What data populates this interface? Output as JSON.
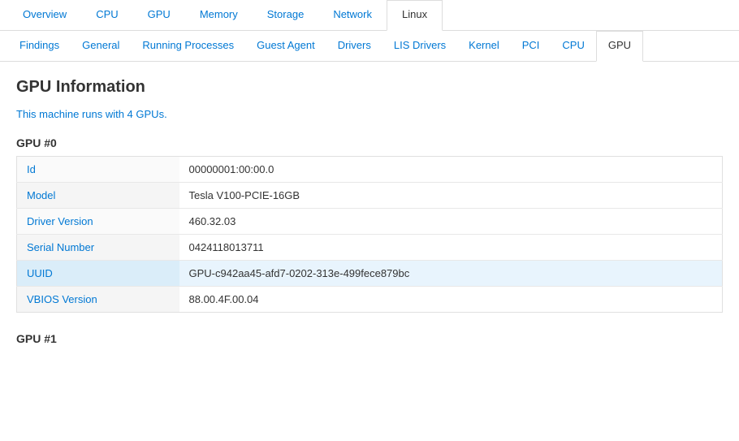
{
  "topNav": {
    "items": [
      {
        "label": "Overview",
        "active": false
      },
      {
        "label": "CPU",
        "active": false
      },
      {
        "label": "GPU",
        "active": false
      },
      {
        "label": "Memory",
        "active": false
      },
      {
        "label": "Storage",
        "active": false
      },
      {
        "label": "Network",
        "active": false
      },
      {
        "label": "Linux",
        "active": true
      }
    ]
  },
  "secondNav": {
    "items": [
      {
        "label": "Findings",
        "active": false
      },
      {
        "label": "General",
        "active": false
      },
      {
        "label": "Running Processes",
        "active": false
      },
      {
        "label": "Guest Agent",
        "active": false
      },
      {
        "label": "Drivers",
        "active": false
      },
      {
        "label": "LIS Drivers",
        "active": false
      },
      {
        "label": "Kernel",
        "active": false
      },
      {
        "label": "PCI",
        "active": false
      },
      {
        "label": "CPU",
        "active": false
      },
      {
        "label": "GPU",
        "active": true
      }
    ]
  },
  "pageTitle": "GPU Information",
  "gpuSummary": "This machine runs with 4 GPUs.",
  "gpuSections": [
    {
      "title": "GPU #0",
      "rows": [
        {
          "label": "Id",
          "value": "00000001:00:00.0",
          "highlighted": false
        },
        {
          "label": "Model",
          "value": "Tesla V100-PCIE-16GB",
          "highlighted": false
        },
        {
          "label": "Driver Version",
          "value": "460.32.03",
          "highlighted": false
        },
        {
          "label": "Serial Number",
          "value": "0424118013711",
          "highlighted": false
        },
        {
          "label": "UUID",
          "value": "GPU-c942aa45-afd7-0202-313e-499fece879bc",
          "highlighted": true
        },
        {
          "label": "VBIOS Version",
          "value": "88.00.4F.00.04",
          "highlighted": false
        }
      ]
    },
    {
      "title": "GPU #1",
      "rows": []
    }
  ]
}
